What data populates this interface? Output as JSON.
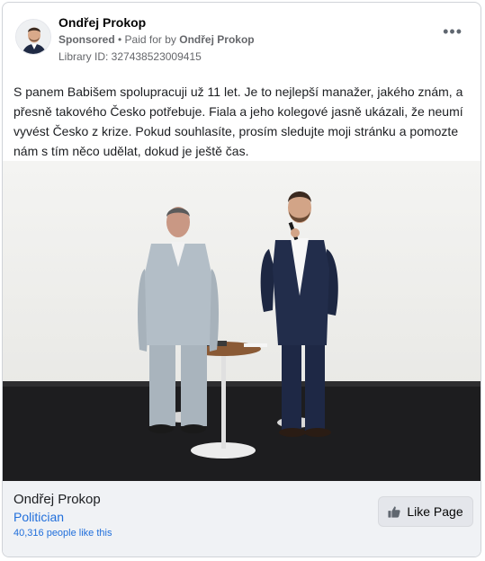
{
  "post": {
    "author": "Ondřej Prokop",
    "sponsored_label": "Sponsored",
    "paid_for_prefix": "• Paid for by",
    "paid_for_name": "Ondřej Prokop",
    "library_id": "Library ID: 327438523009415",
    "more_label": "•••",
    "body": "S panem Babišem spolupracuji už 11 let. Je to nejlepší manažer, jakého znám, a přesně takového Česko potřebuje. Fiala a jeho kolegové jasně ukázali, že neumí vyvést Česko z krize. Pokud souhlasíte, prosím sledujte moji stránku a pomozte nám s tím něco udělat, dokud je ještě čas."
  },
  "page": {
    "name": "Ondřej Prokop",
    "category": "Politician",
    "likes": "40,316 people like this",
    "like_button": "Like Page"
  },
  "icons": {
    "more": "more-options-icon",
    "like": "thumbs-up-icon"
  },
  "colors": {
    "link": "#216fdb",
    "footer_bg": "#f0f2f5"
  }
}
